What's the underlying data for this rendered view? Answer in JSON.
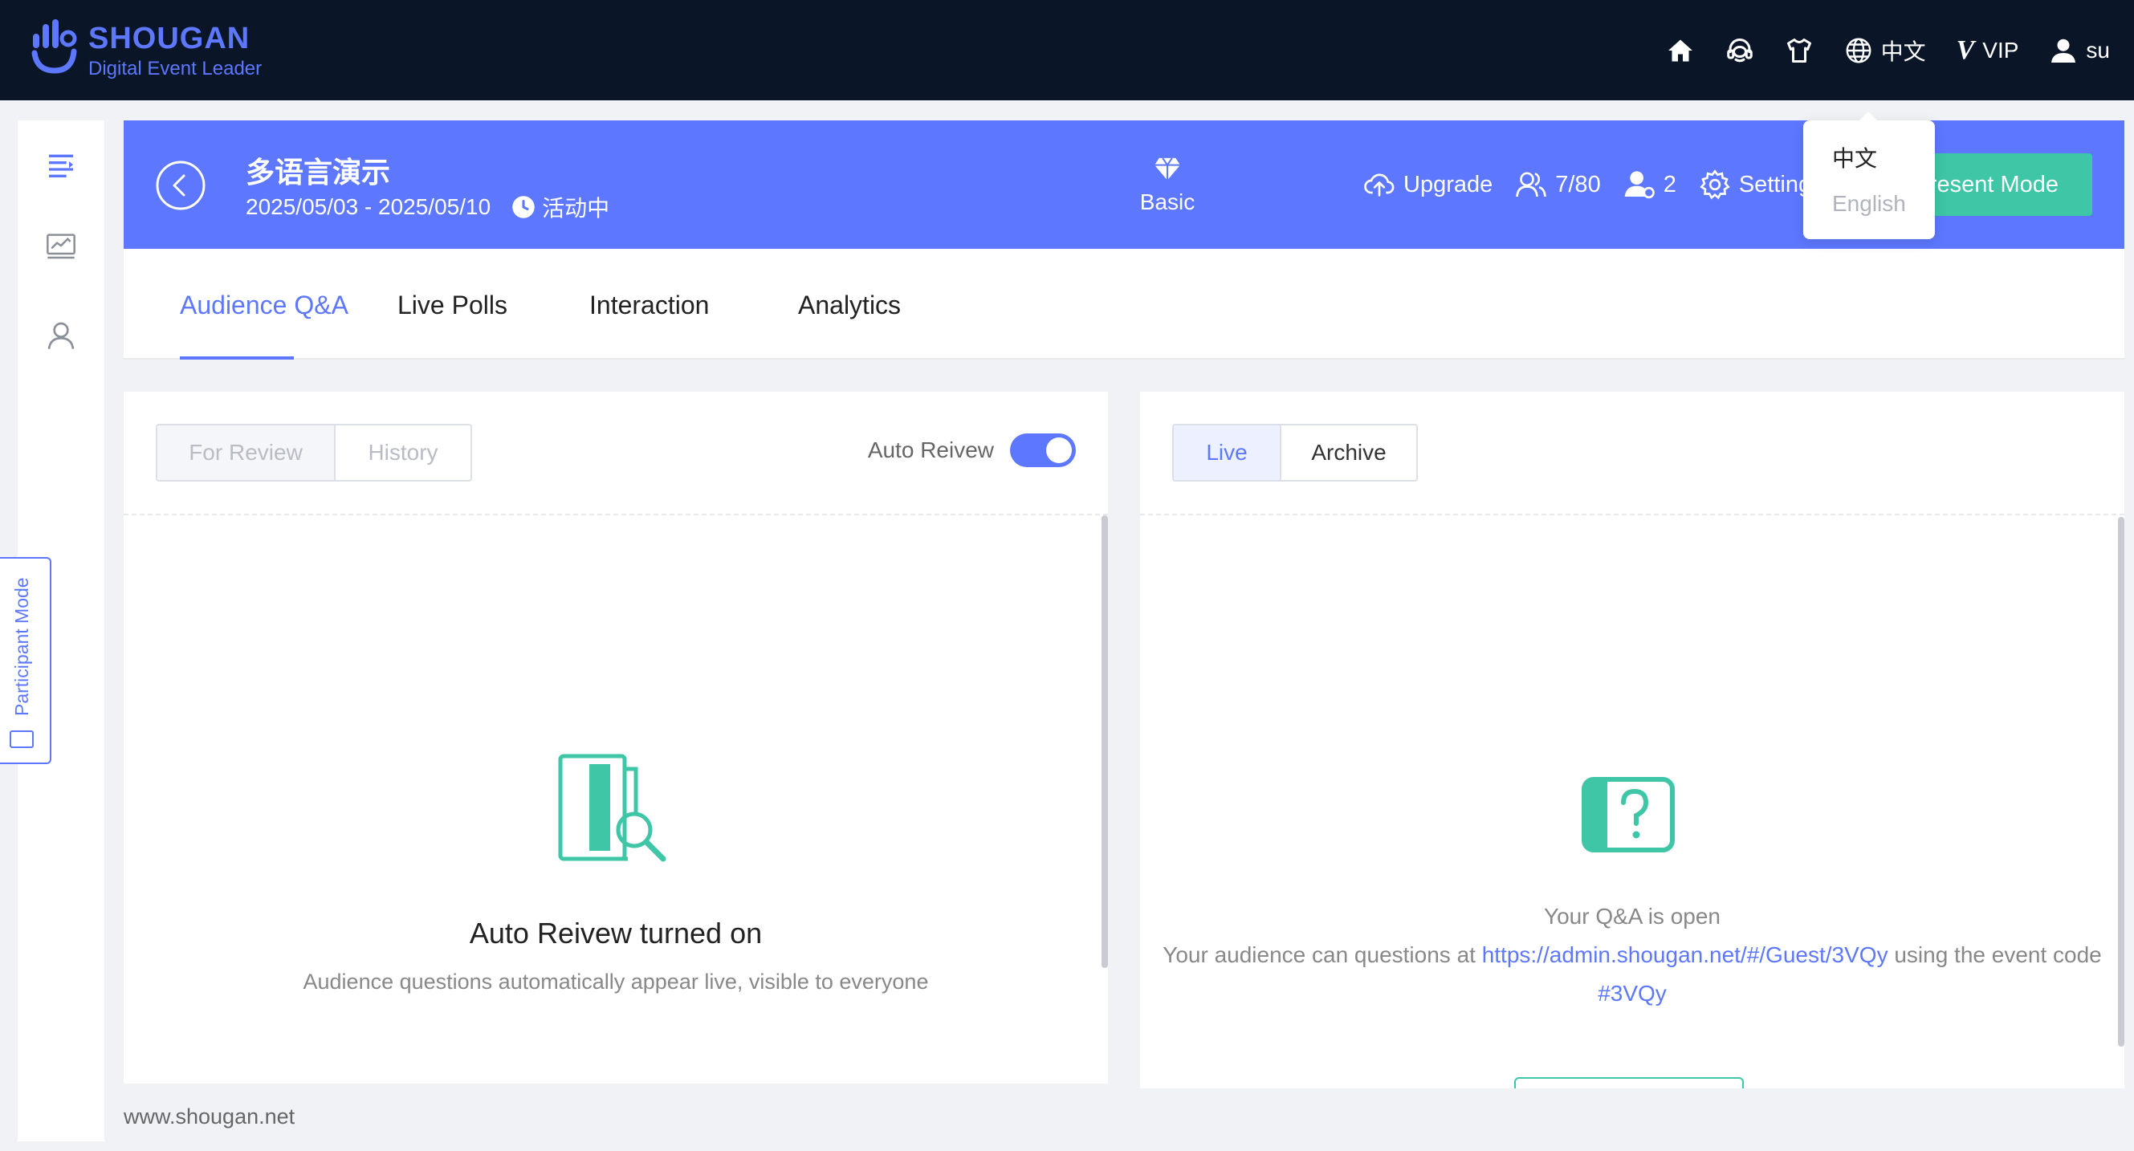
{
  "brand": {
    "name": "SHOUGAN",
    "tagline": "Digital Event Leader",
    "color": "#5d78ff"
  },
  "topnav": {
    "icons": [
      "home-icon",
      "support-icon",
      "shirt-icon",
      "globe-icon",
      "user-icon"
    ],
    "language": "中文",
    "vip_mark": "V",
    "vip_label": "VIP",
    "user": "su"
  },
  "language_menu": {
    "options": [
      "中文",
      "English"
    ],
    "selected": "中文"
  },
  "sidebar": {
    "items": [
      "menu-list-icon",
      "chart-icon",
      "user-icon"
    ],
    "participant_mode": "Participant Mode"
  },
  "event": {
    "title": "多语言演示",
    "dates": "2025/05/03 - 2025/05/10",
    "status": "活动中",
    "plan": "Basic",
    "actions": {
      "upgrade": "Upgrade",
      "attendees": "7/80",
      "hosts": "2",
      "settings": "Settings"
    },
    "present_mode": "Present Mode"
  },
  "tabs": [
    "Audience Q&A",
    "Live Polls",
    "Interaction",
    "Analytics"
  ],
  "active_tab": "Audience Q&A",
  "review_panel": {
    "segments": [
      "For Review",
      "History"
    ],
    "auto_review_label": "Auto Reivew",
    "auto_review_on": true,
    "empty_title": "Auto Reivew turned on",
    "empty_sub": "Audience questions automatically appear live, visible to everyone"
  },
  "live_panel": {
    "segments": [
      "Live",
      "Archive"
    ],
    "active": "Live",
    "open_title": "Your Q&A is open",
    "line_prefix": "Your audience can questions at ",
    "link": "https://admin.shougan.net/#/Guest/3VQy",
    "line_suffix": " using the event code",
    "code": "#3VQy"
  },
  "colors": {
    "topbar": "#0a1628",
    "accent": "#5d78ff",
    "teal": "#3ec6a6",
    "bg": "#f0f2f5"
  },
  "footer": "www.shougan.net"
}
